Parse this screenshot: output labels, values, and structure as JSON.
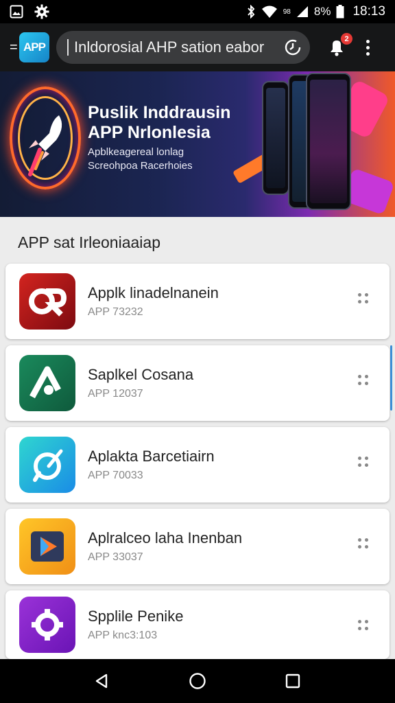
{
  "status_bar": {
    "left_icons": [
      "gallery-icon",
      "settings-icon"
    ],
    "right_icons": [
      "bluetooth-icon",
      "wifi-icon",
      "signal-icon",
      "battery-icon"
    ],
    "network_label": "98",
    "battery_text": "8%",
    "time": "18:13"
  },
  "app_bar": {
    "menu_glyph": "=",
    "logo_text": "APP",
    "search_text": "Inldorosial  AHP  sation eabor",
    "notification_count": "2"
  },
  "banner": {
    "headline_1": "Puslik Inddrausin",
    "headline_2": "APP Nrlonlesia",
    "sub_1": "Apblkeagereal lonlag",
    "sub_2": "Screohpoa Racerhoies"
  },
  "section": {
    "title": "APP  sat Irleoniaaiap"
  },
  "apps": [
    {
      "name": "Applk linadelnanein",
      "sub": "APP 73232",
      "color": "#c4171c"
    },
    {
      "name": "Saplkel Cosana",
      "sub": "APP 12037",
      "color": "#12704b"
    },
    {
      "name": "Aplakta Barcetiairn",
      "sub": "APP 70033",
      "color": "#1aa6e6"
    },
    {
      "name": "Aplralceo laha Inenban",
      "sub": "APP 33037",
      "color": "#f2a71b"
    },
    {
      "name": "Spplile Penike",
      "sub": "APP knc3:103",
      "color": "#8c23c9"
    }
  ],
  "nav_bar": {
    "buttons": [
      "back-icon",
      "home-icon",
      "recents-icon"
    ]
  }
}
